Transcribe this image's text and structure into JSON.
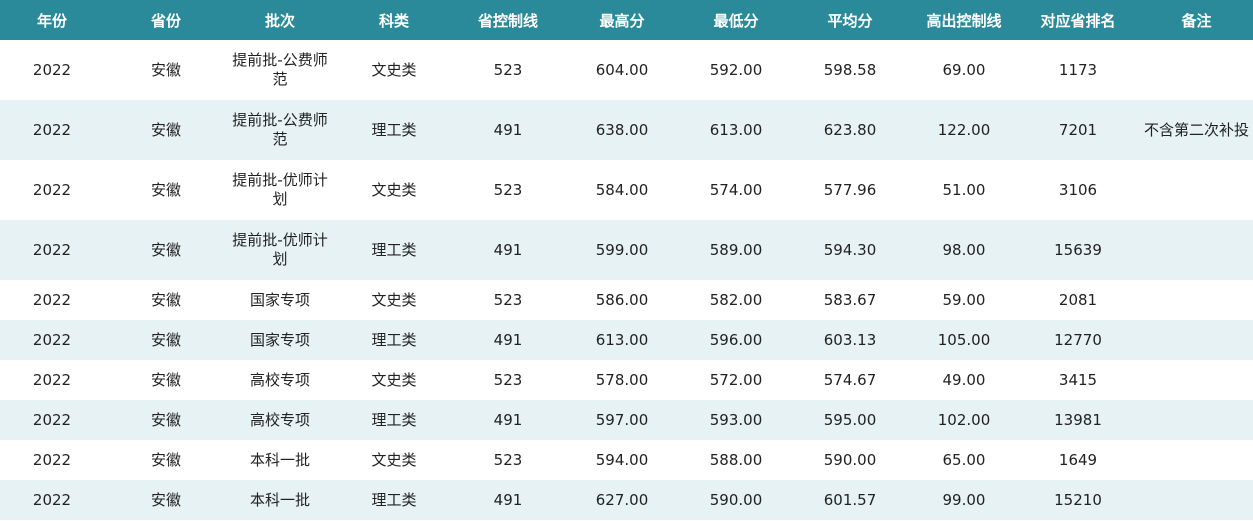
{
  "colors": {
    "header_bg": "#2a8a99",
    "header_text": "#ffffff",
    "row_alt_bg": "#e6f2f4",
    "row_bg": "#ffffff"
  },
  "table": {
    "headers": [
      "年份",
      "省份",
      "批次",
      "科类",
      "省控制线",
      "最高分",
      "最低分",
      "平均分",
      "高出控制线",
      "对应省排名",
      "备注"
    ],
    "rows": [
      [
        "2022",
        "安徽",
        "提前批-公费师范",
        "文史类",
        "523",
        "604.00",
        "592.00",
        "598.58",
        "69.00",
        "1173",
        ""
      ],
      [
        "2022",
        "安徽",
        "提前批-公费师范",
        "理工类",
        "491",
        "638.00",
        "613.00",
        "623.80",
        "122.00",
        "7201",
        "不含第二次补投"
      ],
      [
        "2022",
        "安徽",
        "提前批-优师计划",
        "文史类",
        "523",
        "584.00",
        "574.00",
        "577.96",
        "51.00",
        "3106",
        ""
      ],
      [
        "2022",
        "安徽",
        "提前批-优师计划",
        "理工类",
        "491",
        "599.00",
        "589.00",
        "594.30",
        "98.00",
        "15639",
        ""
      ],
      [
        "2022",
        "安徽",
        "国家专项",
        "文史类",
        "523",
        "586.00",
        "582.00",
        "583.67",
        "59.00",
        "2081",
        ""
      ],
      [
        "2022",
        "安徽",
        "国家专项",
        "理工类",
        "491",
        "613.00",
        "596.00",
        "603.13",
        "105.00",
        "12770",
        ""
      ],
      [
        "2022",
        "安徽",
        "高校专项",
        "文史类",
        "523",
        "578.00",
        "572.00",
        "574.67",
        "49.00",
        "3415",
        ""
      ],
      [
        "2022",
        "安徽",
        "高校专项",
        "理工类",
        "491",
        "597.00",
        "593.00",
        "595.00",
        "102.00",
        "13981",
        ""
      ],
      [
        "2022",
        "安徽",
        "本科一批",
        "文史类",
        "523",
        "594.00",
        "588.00",
        "590.00",
        "65.00",
        "1649",
        ""
      ],
      [
        "2022",
        "安徽",
        "本科一批",
        "理工类",
        "491",
        "627.00",
        "590.00",
        "601.57",
        "99.00",
        "15210",
        ""
      ]
    ]
  }
}
